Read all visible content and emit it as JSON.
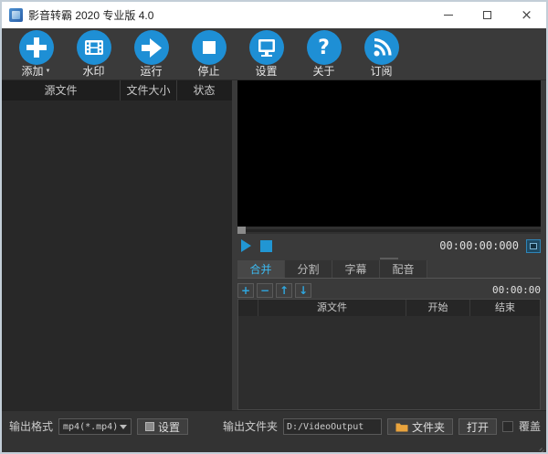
{
  "window": {
    "title": "影音转霸 2020 专业版 4.0"
  },
  "toolbar": {
    "buttons": [
      {
        "label": "添加",
        "icon": "plus-icon",
        "has_dropdown": true
      },
      {
        "label": "水印",
        "icon": "film-icon"
      },
      {
        "label": "运行",
        "icon": "arrow-right-icon"
      },
      {
        "label": "停止",
        "icon": "stop-icon"
      },
      {
        "label": "设置",
        "icon": "monitor-icon"
      },
      {
        "label": "关于",
        "icon": "question-icon"
      },
      {
        "label": "订阅",
        "icon": "rss-icon"
      }
    ]
  },
  "icons": {
    "question": "?",
    "add": "+",
    "remove": "−",
    "move_up": "↑",
    "move_down": "↓"
  },
  "file_list": {
    "columns": [
      "源文件",
      "文件大小",
      "状态"
    ],
    "rows": []
  },
  "player": {
    "time": "00:00:00:000"
  },
  "clip_panel": {
    "tabs": [
      {
        "label": "合并",
        "active": true
      },
      {
        "label": "分割",
        "active": false
      },
      {
        "label": "字幕",
        "active": false
      },
      {
        "label": "配音",
        "active": false
      }
    ],
    "duration": "00:00:00",
    "columns": [
      "源文件",
      "开始",
      "结束"
    ],
    "rows": []
  },
  "bottom_bar": {
    "output_format_label": "输出格式",
    "format_value": "mp4(*.mp4)",
    "settings_button": "设置",
    "output_folder_label": "输出文件夹",
    "output_folder_value": "D:/VideoOutput",
    "folder_button": "文件夹",
    "open_button": "打开",
    "overwrite_label": "覆盖"
  },
  "colors": {
    "accent_blue": "#1e8fd5",
    "icon_blue": "#2fa7e0",
    "active_tab_text": "#3cb9f0",
    "folder_yellow": "#e8a33d",
    "video_bg": "#000000"
  }
}
